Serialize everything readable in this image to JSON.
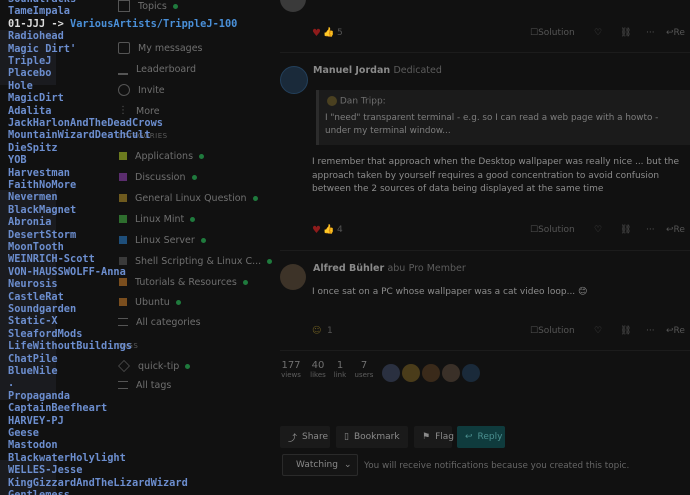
{
  "sidebar": {
    "top_items": [
      {
        "label": "Topics",
        "icon": "topics-icon"
      },
      {
        "label": "My messages",
        "icon": "messages-icon"
      },
      {
        "label": "Leaderboard",
        "icon": "leaderboard-icon"
      },
      {
        "label": "Invite",
        "icon": "invite-icon"
      },
      {
        "label": "More",
        "icon": "more-icon"
      }
    ],
    "categories_header": "CATEGORIES",
    "categories": [
      {
        "label": "Applications",
        "color": "#6b7a1e"
      },
      {
        "label": "Discussion",
        "color": "#5b2d6e"
      },
      {
        "label": "General Linux Question",
        "color": "#6e5a1e"
      },
      {
        "label": "Linux Mint",
        "color": "#2e6e2e"
      },
      {
        "label": "Linux Server",
        "color": "#1e4e7a"
      },
      {
        "label": "Shell Scripting & Linux C...",
        "color": "#3a3a3a"
      },
      {
        "label": "Tutorials & Resources",
        "color": "#7a4e1e"
      },
      {
        "label": "Ubuntu",
        "color": "#7a4e1e"
      }
    ],
    "all_categories": "All categories",
    "tags_header": "TAGS",
    "tags": [
      {
        "label": "quick-tip"
      }
    ],
    "all_tags": "All tags"
  },
  "posts": {
    "first_actions": {
      "likes": "5",
      "solution": "Solution",
      "reply": "Re"
    },
    "second": {
      "user": "Manuel Jordan",
      "title": "Dedicated",
      "quote_author": "Dan Tripp:",
      "quote_text": "I \"need\" transparent terminal - e.g. so I can read a web page with a howto - under my terminal window...",
      "text": "I remember that approach when the Desktop wallpaper was really nice ... but the approach taken by yourself requires a good concentration to avoid confusion between the 2 sources of data being displayed at the same time",
      "likes": "4",
      "solution": "Solution",
      "reply": "Re"
    },
    "third": {
      "user": "Alfred Bühler",
      "handle": "abu",
      "title": "Pro Member",
      "text": "I once sat on a PC whose wallpaper was a cat video loop... 😊",
      "likes": "1",
      "solution": "Solution",
      "reply": "Re"
    }
  },
  "stats": [
    {
      "value": "177",
      "label": "views"
    },
    {
      "value": "40",
      "label": "likes"
    },
    {
      "value": "1",
      "label": "link"
    },
    {
      "value": "7",
      "label": "users"
    }
  ],
  "controls": {
    "share": "Share",
    "bookmark": "Bookmark",
    "flag": "Flag",
    "reply": "Reply",
    "watching": "Watching",
    "notify": "You will receive notifications because you created this topic."
  },
  "terminal": {
    "lines": [
      "Soundtracks",
      "TameImpala",
      "01-JJJ -> VariousArtists/TrippleJ-100",
      "Radiohead",
      "Magic Dirt'",
      "TripleJ",
      "Placebo",
      "Hole",
      "MagicDirt",
      "Adalita",
      "JackHarlonAndTheDeadCrows",
      "MountainWizardDeathCult",
      "DieSpitz",
      "YOB",
      "Harvestman",
      "FaithNoMore",
      "Nevermen",
      "BlackMagnet",
      "Abronia",
      "DesertStorm",
      "MoonTooth",
      "WEINRICH-Scott",
      "VON-HAUSSWOLFF-Anna",
      "Neurosis",
      "CastleRat",
      "Soundgarden",
      "Static-X",
      "SleafordMods",
      "LifeWithoutBuildings",
      "ChatPile",
      "BlueNile",
      ".",
      "Propaganda",
      "CaptainBeefheart",
      "HARVEY-PJ",
      "Geese",
      "Mastodon",
      "BlackwaterHolylight",
      "WELLES-Jesse",
      "KingGizzardAndTheLizardWizard",
      "Gentlemess"
    ]
  }
}
